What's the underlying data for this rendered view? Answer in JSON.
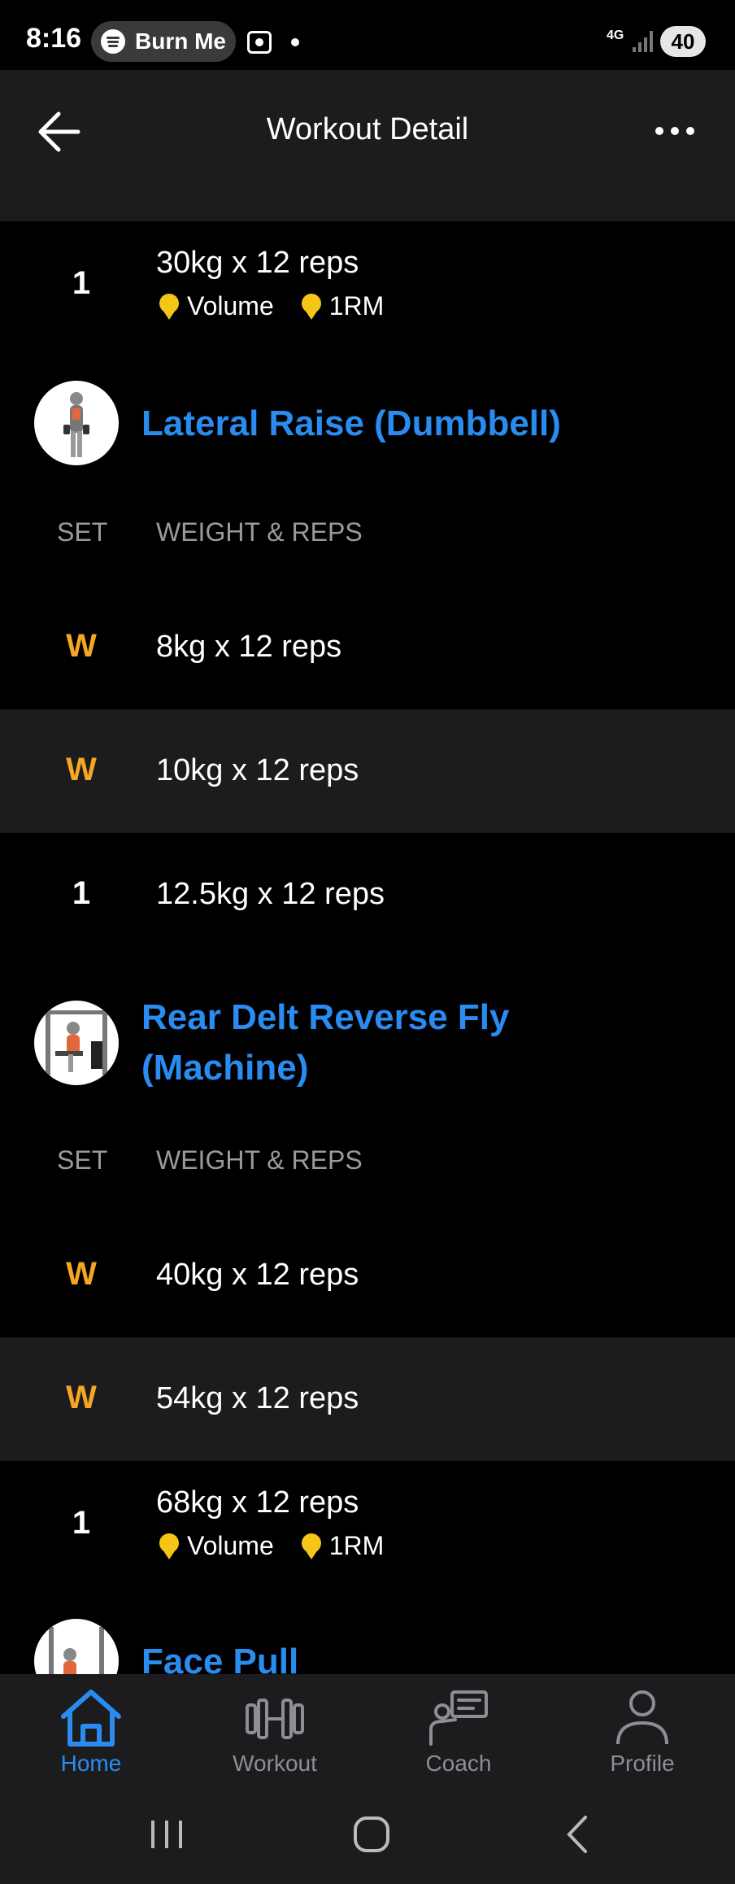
{
  "status": {
    "time": "8:16",
    "spotify_label": "Burn Me",
    "network": "4G",
    "battery": "40"
  },
  "header": {
    "title": "Workout Detail"
  },
  "sets_top": [
    {
      "set": "1",
      "wr": "30kg x 12 reps",
      "prs": [
        "Volume",
        "1RM"
      ]
    }
  ],
  "exercises": [
    {
      "title": "Lateral Raise (Dumbbell)",
      "col_set": "SET",
      "col_wr": "WEIGHT & REPS",
      "sets": [
        {
          "set": "W",
          "wr": "8kg x 12 reps"
        },
        {
          "set": "W",
          "wr": "10kg x 12 reps"
        },
        {
          "set": "1",
          "wr": "12.5kg x 12 reps"
        }
      ]
    },
    {
      "title_line1": "Rear Delt Reverse Fly",
      "title_line2": "(Machine)",
      "col_set": "SET",
      "col_wr": "WEIGHT & REPS",
      "sets": [
        {
          "set": "W",
          "wr": "40kg x 12 reps"
        },
        {
          "set": "W",
          "wr": "54kg x 12 reps"
        },
        {
          "set": "1",
          "wr": "68kg x 12 reps",
          "prs": [
            "Volume",
            "1RM"
          ]
        }
      ]
    },
    {
      "title": "Face Pull"
    }
  ],
  "nav": {
    "home": "Home",
    "workout": "Workout",
    "coach": "Coach",
    "profile": "Profile"
  },
  "colors": {
    "accent": "#2a8cf0",
    "warmup": "#f5a623",
    "medal": "#f5c518",
    "surface": "#1c1c1e"
  }
}
